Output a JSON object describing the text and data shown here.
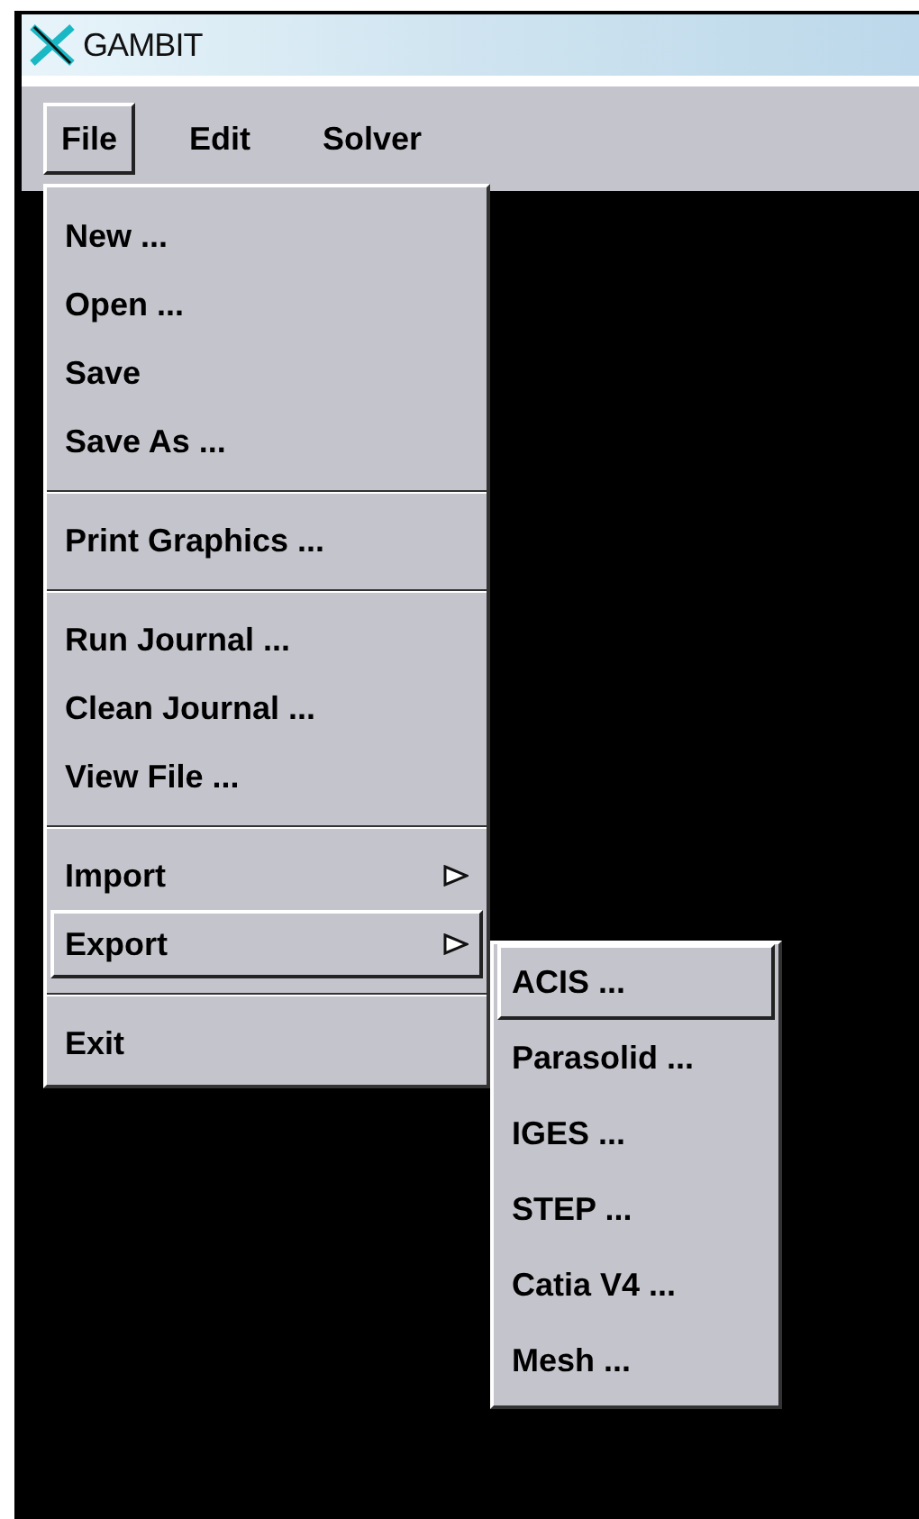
{
  "window": {
    "title": "GAMBIT"
  },
  "menu_bar": [
    {
      "label": "File",
      "selected": true
    },
    {
      "label": "Edit",
      "selected": false
    },
    {
      "label": "Solver",
      "selected": false
    }
  ],
  "file_menu": {
    "items": [
      {
        "kind": "command",
        "label": "New ...",
        "selected": false
      },
      {
        "kind": "command",
        "label": "Open ...",
        "selected": false
      },
      {
        "kind": "command",
        "label": "Save",
        "selected": false
      },
      {
        "kind": "command",
        "label": "Save As ...",
        "selected": false
      },
      {
        "kind": "separator"
      },
      {
        "kind": "command",
        "label": "Print Graphics ...",
        "selected": false
      },
      {
        "kind": "separator"
      },
      {
        "kind": "command",
        "label": "Run Journal ...",
        "selected": false
      },
      {
        "kind": "command",
        "label": "Clean Journal ...",
        "selected": false
      },
      {
        "kind": "command",
        "label": "View File ...",
        "selected": false
      },
      {
        "kind": "separator"
      },
      {
        "kind": "cascade",
        "label": "Import",
        "selected": false
      },
      {
        "kind": "cascade",
        "label": "Export",
        "selected": true
      },
      {
        "kind": "separator"
      },
      {
        "kind": "command",
        "label": "Exit",
        "selected": false
      }
    ]
  },
  "export_submenu": {
    "items": [
      {
        "kind": "command",
        "label": "ACIS ...",
        "selected": true
      },
      {
        "kind": "command",
        "label": "Parasolid ...",
        "selected": false
      },
      {
        "kind": "command",
        "label": "IGES ...",
        "selected": false
      },
      {
        "kind": "command",
        "label": "STEP ...",
        "selected": false
      },
      {
        "kind": "command",
        "label": "Catia V4 ...",
        "selected": false
      },
      {
        "kind": "command",
        "label": "Mesh ...",
        "selected": false
      }
    ]
  }
}
